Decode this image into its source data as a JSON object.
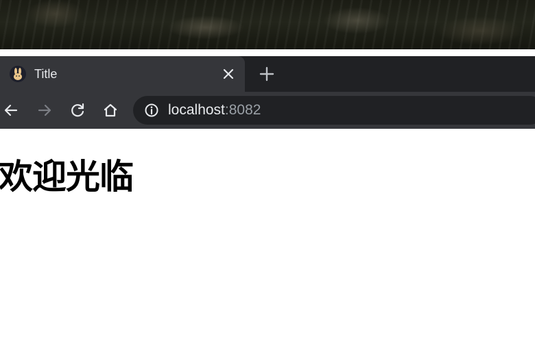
{
  "browser": {
    "tab": {
      "title": "Title",
      "favicon": "bunny-favicon-icon",
      "close_icon": "close-icon"
    },
    "new_tab_icon": "plus-icon",
    "toolbar": {
      "back_icon": "arrow-left-icon",
      "forward_icon": "arrow-right-icon",
      "reload_icon": "reload-icon",
      "home_icon": "home-icon"
    },
    "omnibox": {
      "info_icon": "info-icon",
      "host": "localhost",
      "port": ":8082"
    },
    "colors": {
      "tabstrip": "#202124",
      "active_tab": "#35363a",
      "text": "#e8eaed",
      "dim_text": "#9aa0a6"
    }
  },
  "page": {
    "heading": "欢迎光临"
  }
}
